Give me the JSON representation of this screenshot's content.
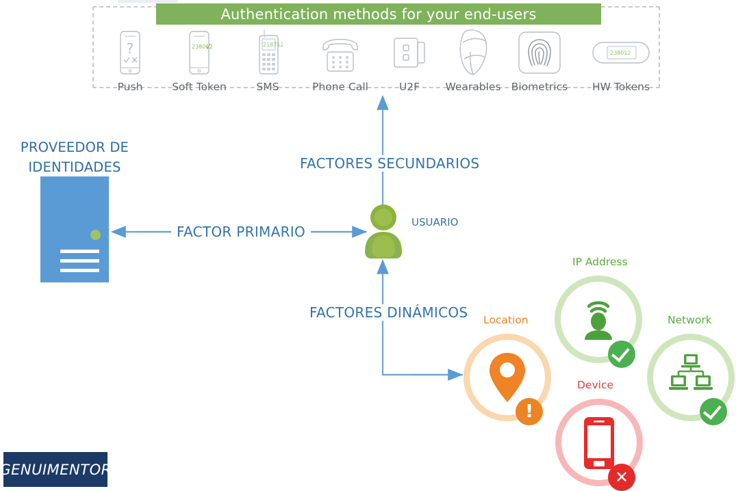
{
  "methods_panel": {
    "banner_title": "Authentication methods for your end-users",
    "banner_color": "#7fb25a",
    "methods": [
      {
        "label": "Push",
        "icon": "push-phone-icon",
        "screen_text": ""
      },
      {
        "label": "Soft Token",
        "icon": "soft-token-phone-icon",
        "screen_text": "238012"
      },
      {
        "label": "SMS",
        "icon": "sms-feature-phone-icon",
        "screen_text": "218712"
      },
      {
        "label": "Phone Call",
        "icon": "desk-phone-icon",
        "screen_text": ""
      },
      {
        "label": "U2F",
        "icon": "u2f-usb-key-icon",
        "screen_text": ""
      },
      {
        "label": "Wearables",
        "icon": "smartwatch-icon",
        "screen_text": ""
      },
      {
        "label": "Biometrics",
        "icon": "fingerprint-icon",
        "screen_text": ""
      },
      {
        "label": "HW Tokens",
        "icon": "hardware-token-icon",
        "screen_text": "238012"
      }
    ]
  },
  "identity_provider": {
    "title_line1": "PROVEEDOR DE",
    "title_line2": "IDENTIDADES",
    "server_color": "#5b9bd5",
    "status_dot_color": "#9dc565"
  },
  "flows": {
    "primary_label": "FACTOR PRIMARIO",
    "secondary_label": "FACTORES SECUNDARIOS",
    "dynamic_label": "FACTORES DINÁMICOS",
    "arrow_color": "#5b9bd5",
    "label_color": "#3273ae"
  },
  "user": {
    "label": "USUARIO",
    "figure_color": "#8cb33c"
  },
  "dynamic_factors": [
    {
      "key": "ip",
      "label": "IP Address",
      "status": "ok",
      "status_glyph": "check",
      "color": "#5aab3f",
      "ring_color": "#cfe6bd",
      "badge_color": "#4caf50",
      "icon": "wifi-user-icon"
    },
    {
      "key": "location",
      "label": "Location",
      "status": "warning",
      "status_glyph": "exclamation",
      "color": "#ef8326",
      "ring_color": "#fad7ad",
      "badge_color": "#ec8426",
      "icon": "map-pin-icon"
    },
    {
      "key": "device",
      "label": "Device",
      "status": "blocked",
      "status_glyph": "cross",
      "color": "#e63c3c",
      "ring_color": "#f8b7b7",
      "badge_color": "#e32b2b",
      "icon": "smartphone-icon"
    },
    {
      "key": "network",
      "label": "Network",
      "status": "ok",
      "status_glyph": "check",
      "color": "#5aab3f",
      "ring_color": "#cfe6bd",
      "badge_color": "#4caf50",
      "icon": "network-computers-icon"
    }
  ],
  "logo": {
    "text": "GENUIMENTOR",
    "background": "#1b3a66"
  }
}
